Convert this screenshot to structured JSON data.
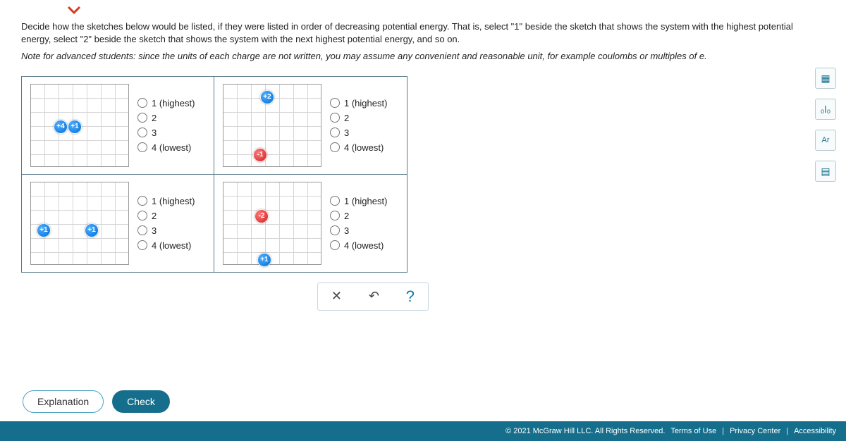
{
  "question": {
    "line1": "Decide how the sketches below would be listed, if they were listed in order of decreasing potential energy. That is, select \"1\" beside the sketch that shows the system with the highest potential energy, select \"2\" beside the sketch that shows the system with the next highest potential energy, and so on.",
    "note_prefix": "Note for advanced students:",
    "note_rest": " since the units of each charge are not written, you may assume any convenient and reasonable unit, for example coulombs or multiples of ",
    "note_unit": "e",
    "note_period": "."
  },
  "options": {
    "opt1": "1 (highest)",
    "opt2": "2",
    "opt3": "3",
    "opt4": "4 (lowest)"
  },
  "charges": {
    "a1": "+4",
    "a2": "+1",
    "b1": "+2",
    "b2": "-1",
    "c1": "+1",
    "c2": "+1",
    "d1": "-2",
    "d2": "+1"
  },
  "toolbar": {
    "close": "✕",
    "undo": "↶",
    "help": "?"
  },
  "buttons": {
    "explanation": "Explanation",
    "check": "Check"
  },
  "footer": {
    "copyright": "© 2021 McGraw Hill LLC. All Rights Reserved.",
    "terms": "Terms of Use",
    "privacy": "Privacy Center",
    "accessibility": "Accessibility",
    "sep": "|"
  },
  "side": {
    "calc": "▦",
    "chart": "₀l₀",
    "ar": "Ar",
    "table": "▤"
  }
}
